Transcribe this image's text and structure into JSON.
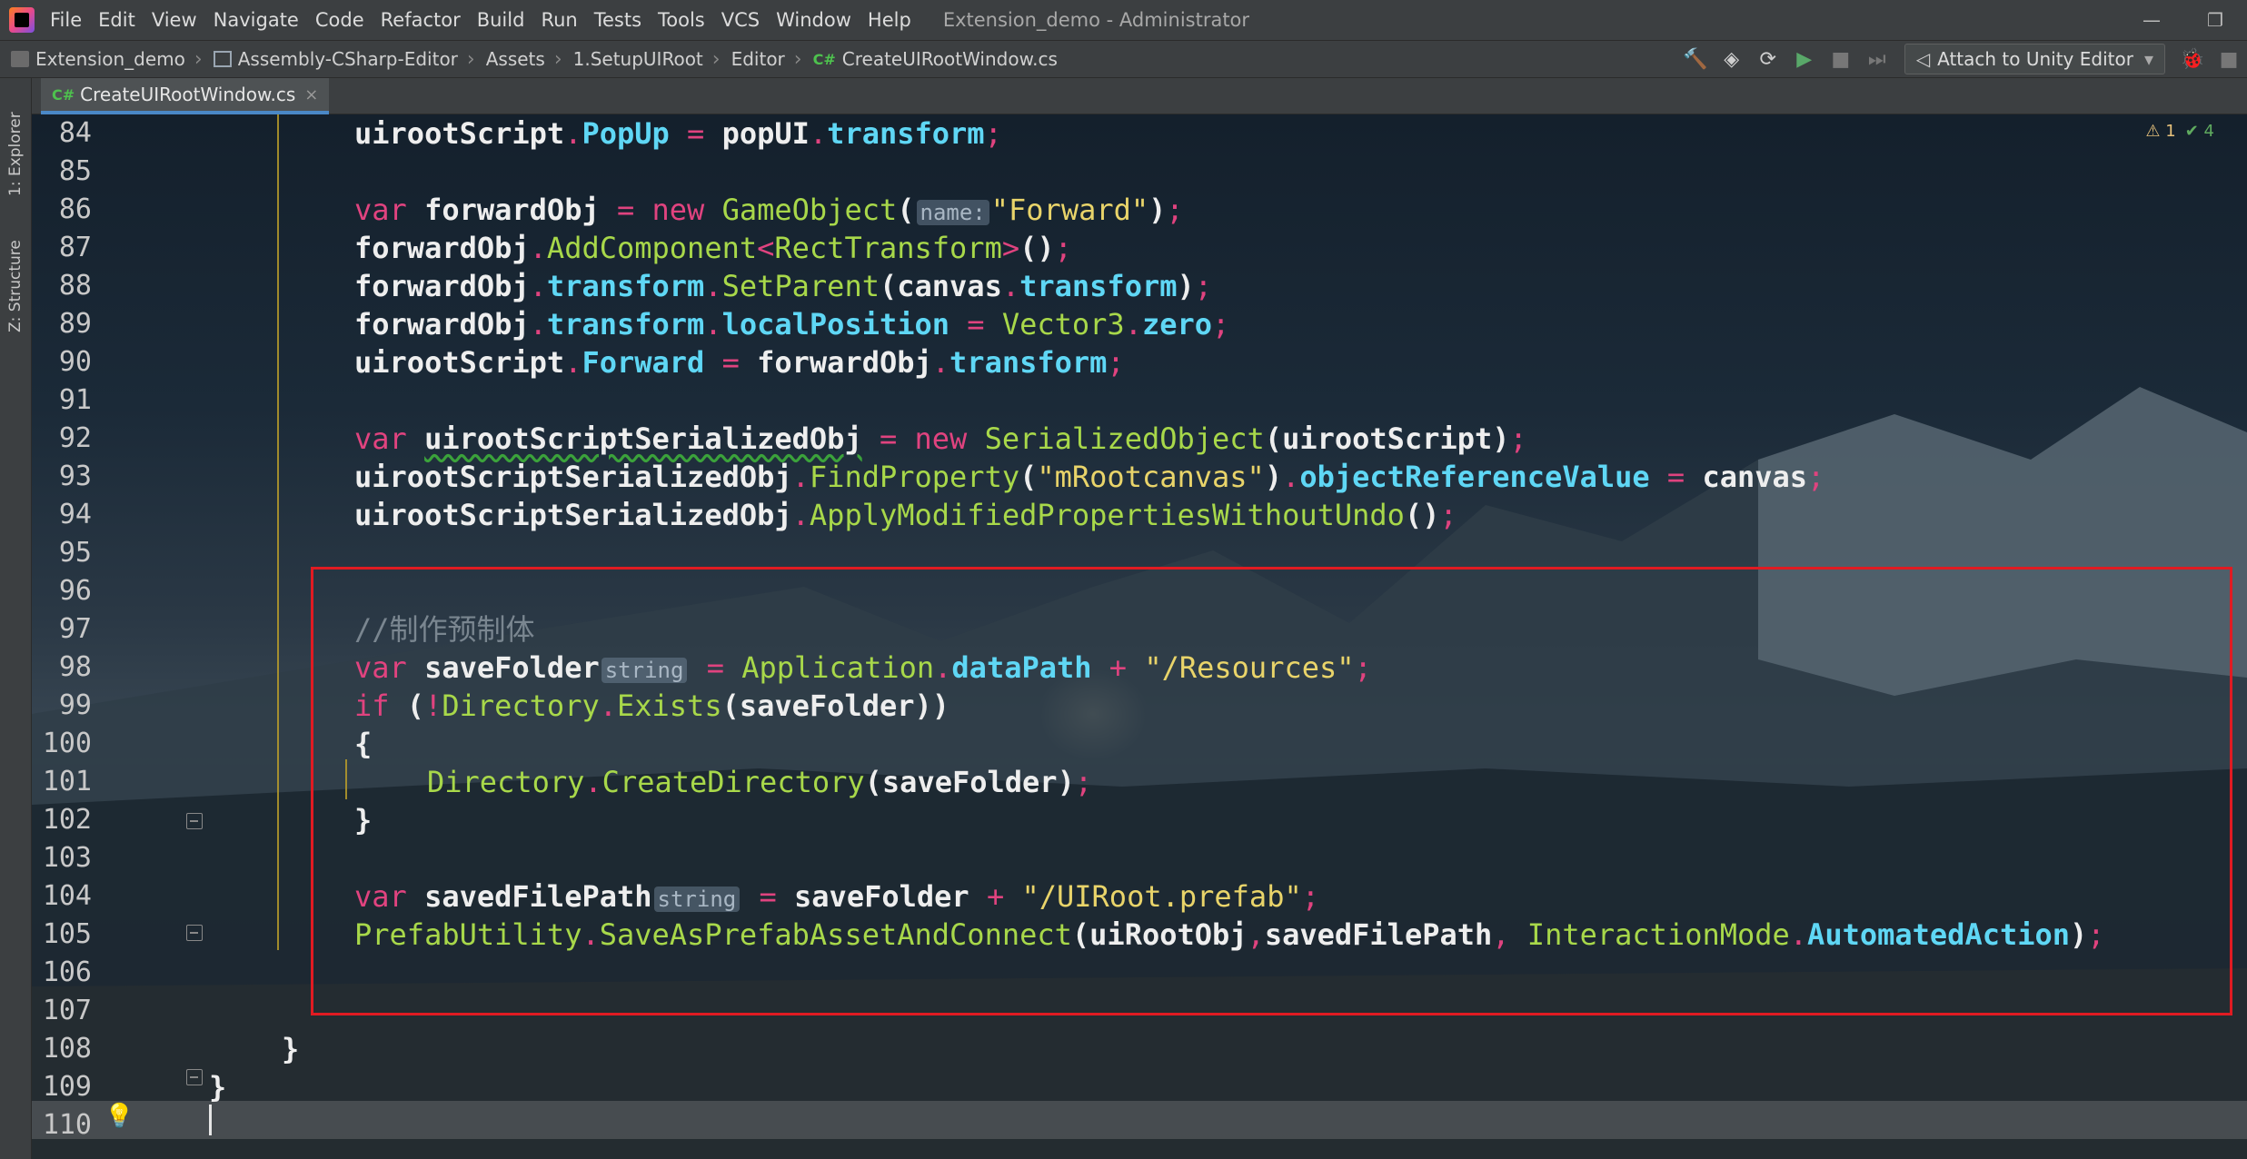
{
  "titlebar": {
    "menu": [
      "File",
      "Edit",
      "View",
      "Navigate",
      "Code",
      "Refactor",
      "Build",
      "Run",
      "Tests",
      "Tools",
      "VCS",
      "Window",
      "Help"
    ],
    "window_title": "Extension_demo - Administrator"
  },
  "breadcrumb": {
    "project": "Extension_demo",
    "assembly": "Assembly-CSharp-Editor",
    "folders": [
      "Assets",
      "1.SetupUIRoot",
      "Editor"
    ],
    "file_lang": "C#",
    "file": "CreateUIRootWindow.cs"
  },
  "toolbar": {
    "run_config": "Attach to Unity Editor"
  },
  "left_strip": {
    "explorer": "1: Explorer",
    "structure": "Z: Structure"
  },
  "tab": {
    "lang": "C#",
    "file": "CreateUIRootWindow.cs",
    "close": "×"
  },
  "inspection": {
    "warnings": "⚠ 1",
    "ok": "✔ 4"
  },
  "editor": {
    "line_numbers": [
      "84",
      "85",
      "86",
      "87",
      "88",
      "89",
      "90",
      "91",
      "92",
      "93",
      "94",
      "95",
      "96",
      "97",
      "98",
      "99",
      "100",
      "101",
      "102",
      "103",
      "104",
      "105",
      "106",
      "107",
      "108",
      "109",
      "110"
    ],
    "hints": {
      "name": "name:",
      "string1": "string",
      "string2": "string"
    },
    "strings": {
      "forward": "\"Forward\"",
      "root_canvas": "\"mRootcanvas\"",
      "resources": "\"/Resources\"",
      "prefab": "\"/UIRoot.prefab\""
    },
    "comment": "//制作预制体"
  },
  "colors": {
    "keyword": "#e0437f",
    "type": "#a8d84a",
    "property": "#5fd7f5",
    "string": "#e9d46a",
    "highlight_box": "#e01b22"
  }
}
